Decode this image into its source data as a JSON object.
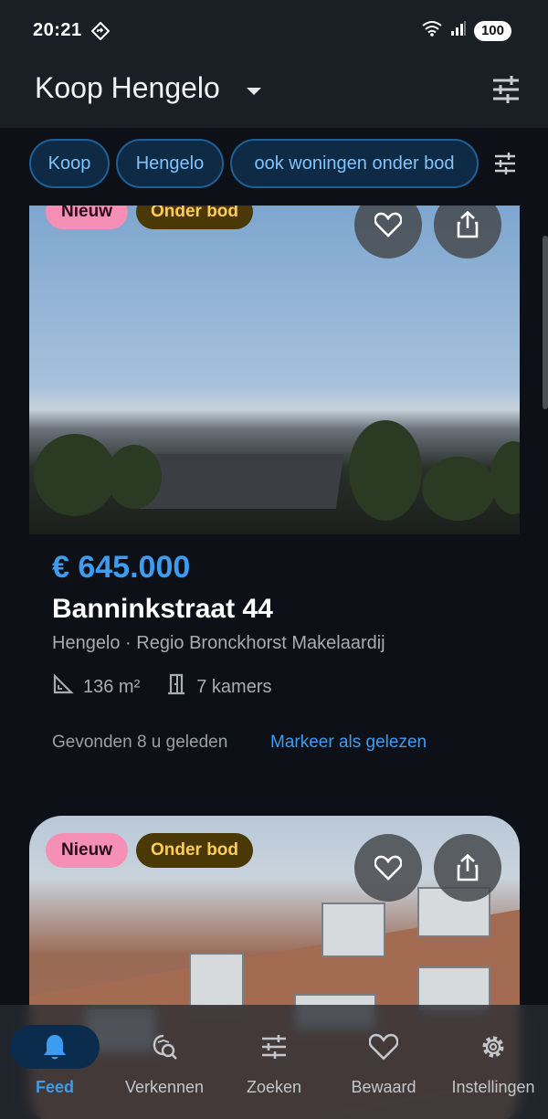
{
  "status_bar": {
    "time": "20:21",
    "battery": "100"
  },
  "app_bar": {
    "title": "Koop Hengelo"
  },
  "filter_chips": [
    "Koop",
    "Hengelo",
    "ook woningen onder bod"
  ],
  "listings": [
    {
      "badges": [
        "Nieuw",
        "Onder bod"
      ],
      "price": "€ 645.000",
      "street": "Banninkstraat 44",
      "location": "Hengelo · Regio Bronckhorst Makelaardij",
      "area": "136 m²",
      "rooms": "7 kamers",
      "found": "Gevonden 8 u geleden",
      "action": "Markeer als gelezen"
    },
    {
      "badges": [
        "Nieuw",
        "Onder bod"
      ]
    }
  ],
  "bottom_nav": [
    {
      "label": "Feed",
      "icon": "bell-icon",
      "active": true
    },
    {
      "label": "Verkennen",
      "icon": "map-search-icon",
      "active": false
    },
    {
      "label": "Zoeken",
      "icon": "tune-icon",
      "active": false
    },
    {
      "label": "Bewaard",
      "icon": "heart-icon",
      "active": false
    },
    {
      "label": "Instellingen",
      "icon": "gear-icon",
      "active": false
    }
  ],
  "colors": {
    "accent": "#3d9cf0",
    "badge_new": "#f58fb5",
    "badge_bid": "#4a3806",
    "background": "#0d1117"
  }
}
